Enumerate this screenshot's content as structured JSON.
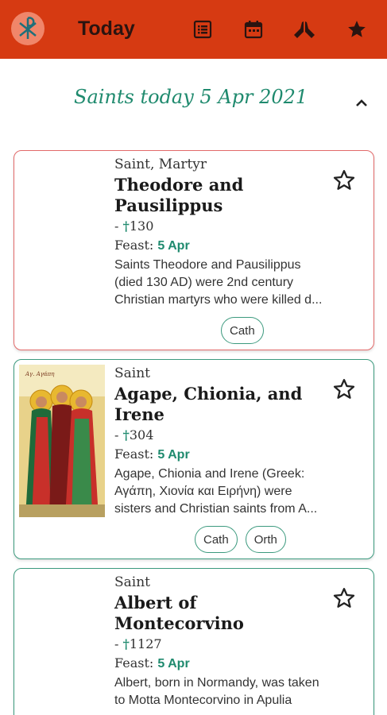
{
  "appbar": {
    "title": "Today",
    "icons": [
      "list-icon",
      "calendar-icon",
      "praying-hands-icon",
      "star-icon"
    ]
  },
  "section": {
    "title": "Saints today 5 Apr 2021"
  },
  "saints": [
    {
      "category": "Saint, Martyr",
      "name_line1": "Theodore and",
      "name_line2": "Pausilippus",
      "dates_prefix": "- ",
      "cross": "†",
      "death": "130",
      "feast_label": "Feast: ",
      "feast_date": "5 Apr",
      "desc_line1": "Saints Theodore and Pausilippus",
      "desc_line2": "(died 130 AD) were 2nd century",
      "desc_line3": "Christian martyrs who were killed d...",
      "tags": [
        "Cath"
      ]
    },
    {
      "category": "Saint",
      "name_line1": "Agape, Chionia, and",
      "name_line2": "Irene",
      "dates_prefix": "- ",
      "cross": "†",
      "death": "304",
      "feast_label": "Feast: ",
      "feast_date": "5 Apr",
      "desc_line1": "Agape, Chionia and Irene (Greek:",
      "desc_line2": "Αγάπη, Χιονία και Ειρήνη) were",
      "desc_line3": "sisters and Christian saints from A...",
      "tags": [
        "Cath",
        "Orth"
      ]
    },
    {
      "category": "Saint",
      "name_line1": "Albert of",
      "name_line2": "Montecorvino",
      "dates_prefix": "- ",
      "cross": "†",
      "death": "1127",
      "feast_label": "Feast: ",
      "feast_date": "5 Apr",
      "desc_line1": "Albert, born in Normandy, was taken",
      "desc_line2": "to Motta Montecorvino in Apulia",
      "desc_line3": "",
      "tags": []
    }
  ],
  "colors": {
    "appbar": "#d63a12",
    "accent": "#1f8a6e",
    "card_border_green": "#3c9a7e",
    "card_border_red": "#e26a6a"
  }
}
